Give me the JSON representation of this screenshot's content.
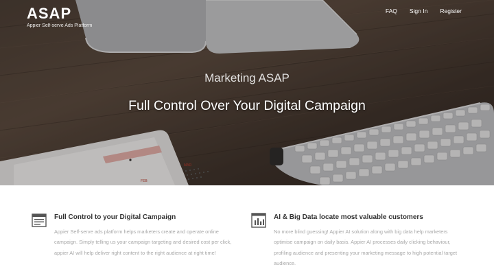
{
  "brand": {
    "logo": "ASAP",
    "tagline": "Appier Self-serve Ads Platform"
  },
  "nav": {
    "items": [
      {
        "label": "FAQ"
      },
      {
        "label": "Sign In"
      },
      {
        "label": "Register"
      }
    ]
  },
  "hero": {
    "subtitle": "Marketing ASAP",
    "title": "Full Control Over Your Digital Campaign",
    "tablet_text": {
      "month_mar": "MAR",
      "month_feb": "FEB"
    }
  },
  "features": [
    {
      "icon": "browser-window-icon",
      "title": "Full Control to your Digital Campaign",
      "text": "Appier Self-serve ads platform helps marketers create and operate online campaign. Simply telling us your campaign targeting and desired cost per click, appier AI will help deliver right content to the right audience at right time!"
    },
    {
      "icon": "bar-chart-icon",
      "title": "AI & Big Data locate most valuable customers",
      "text": "No more blind guessing! Appier AI solution along with big data help marketers optimise campaign on daily basis. Appier AI processes daily clicking behaviour, profiling audience and presenting your marketing message to high potential target audience."
    }
  ],
  "colors": {
    "heading_text": "#333333",
    "body_text": "#a8a8a8",
    "hero_text": "#ffffff"
  }
}
